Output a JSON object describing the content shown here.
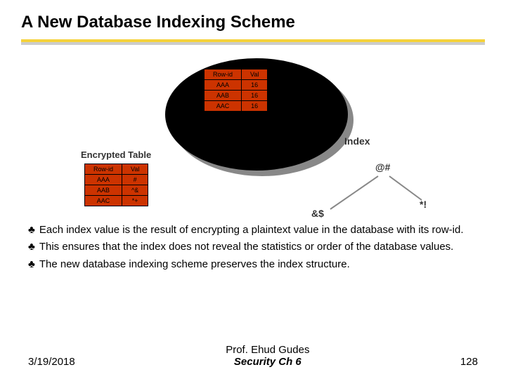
{
  "title": "A New Database Indexing Scheme",
  "inner_table": {
    "headers": [
      "Row-id",
      "Val"
    ],
    "rows": [
      [
        "AAA",
        "16"
      ],
      [
        "AAB",
        "16"
      ],
      [
        "AAC",
        "16"
      ]
    ]
  },
  "encrypted_label": "Encrypted Table",
  "index_label": "Index",
  "enc_table": {
    "headers": [
      "Row-id",
      "Val"
    ],
    "rows": [
      [
        "AAA",
        "#"
      ],
      [
        "AAB",
        "^&"
      ],
      [
        "AAC",
        "*+"
      ]
    ]
  },
  "tree": {
    "root": "@#",
    "left": "&$",
    "right": "*!"
  },
  "bullets": [
    "Each index value is the result of encrypting a plaintext value in the database with its row-id.",
    "This ensures that the index does not reveal the statistics or order of the database values.",
    "The new database indexing scheme preserves the index structure."
  ],
  "footer": {
    "date": "3/19/2018",
    "prof": "Prof. Ehud Gudes",
    "course": "Security  Ch 6",
    "page": "128"
  }
}
